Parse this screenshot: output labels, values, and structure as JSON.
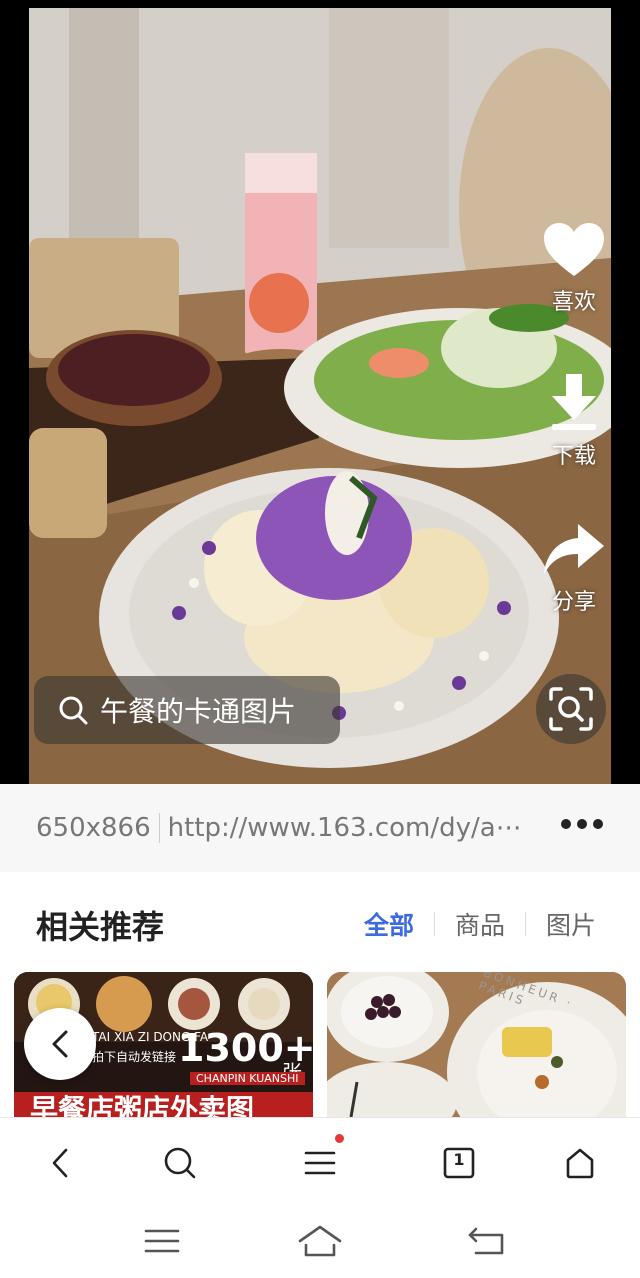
{
  "viewer": {
    "actions": [
      {
        "icon": "heart-icon",
        "label": "喜欢"
      },
      {
        "icon": "download-icon",
        "label": "下载"
      },
      {
        "icon": "share-icon",
        "label": "分享"
      }
    ],
    "search_chip": {
      "icon": "search-icon",
      "text": "午餐的卡通图片"
    },
    "scan_button": {
      "icon": "image-scan-icon"
    }
  },
  "image_info": {
    "dimensions": "650x866",
    "url": "http://www.163.com/dy/a⋯",
    "more_icon": "more-dots-icon"
  },
  "related": {
    "title": "相关推荐",
    "filters": [
      {
        "label": "全部",
        "active": true
      },
      {
        "label": "商品",
        "active": false
      },
      {
        "label": "图片",
        "active": false
      }
    ],
    "thumbs": [
      {
        "big_number": "1300+",
        "unit": "张",
        "pinyin": "TAI XIA ZI DONG FA",
        "sub": "拍下自动发链接",
        "brand": "CHANPIN KUANSHI",
        "headline": "早餐店粥店外卖图"
      },
      {
        "plate_text": "BONHEUR · PARIS"
      }
    ]
  },
  "toolbar": {
    "back_icon": "back-icon",
    "search_icon": "search-icon",
    "menu_icon": "menu-icon",
    "tabs_count": "1",
    "home_icon": "home-icon",
    "accent_dot": "#e53935"
  },
  "system_nav": {
    "menu_icon": "system-menu-icon",
    "home_icon": "system-home-icon",
    "back_icon": "system-back-icon"
  },
  "colors": {
    "accent": "#3c6be0"
  }
}
